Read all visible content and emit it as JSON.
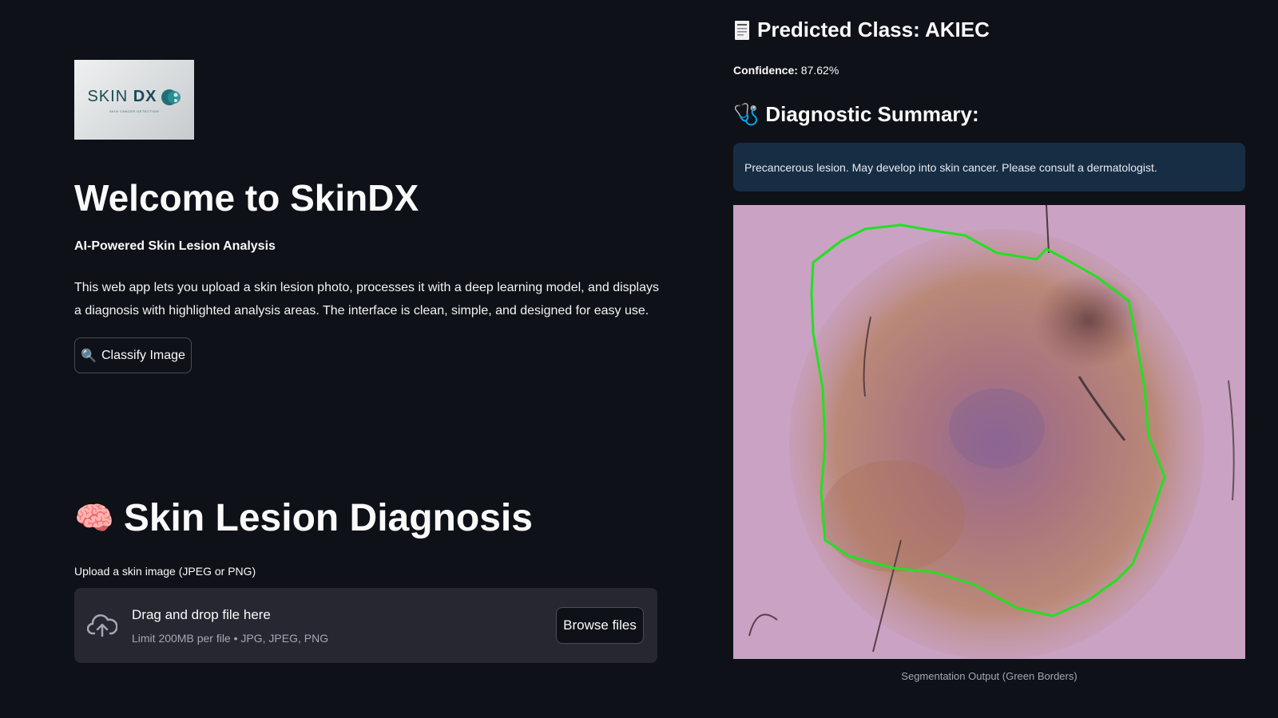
{
  "logo": {
    "text_light": "SKIN ",
    "text_bold": "DX",
    "tagline": "SKIN CANCER DETECTION"
  },
  "hero": {
    "title": "Welcome to SkinDX",
    "subtitle": "AI-Powered Skin Lesion Analysis",
    "description": "This web app lets you upload a skin lesion photo, processes it with a deep learning model, and displays a diagnosis with highlighted analysis areas. The interface is clean, simple, and designed for easy use.",
    "classify_button": {
      "icon": "🔍",
      "label": "Classify Image"
    }
  },
  "diagnosis_section": {
    "icon": "🧠",
    "title": "Skin Lesion Diagnosis",
    "upload_label": "Upload a skin image (JPEG or PNG)",
    "dropzone": {
      "icon": "cloud-upload-icon",
      "title": "Drag and drop file here",
      "limit": "Limit 200MB per file • JPG, JPEG, PNG",
      "browse_label": "Browse files"
    }
  },
  "results": {
    "predicted_label": "Predicted Class: AKIEC",
    "confidence_label": "Confidence:",
    "confidence_value": "87.62%",
    "summary_title": "Diagnostic Summary:",
    "summary_icon": "🩺",
    "summary_text": "Precancerous lesion. May develop into skin cancer. Please consult a dermatologist.",
    "image_caption": "Segmentation Output (Green Borders)"
  },
  "colors": {
    "background": "#0e1117",
    "info_box": "#172d43",
    "dropzone": "#262730",
    "segmentation_border": "#22e022"
  }
}
